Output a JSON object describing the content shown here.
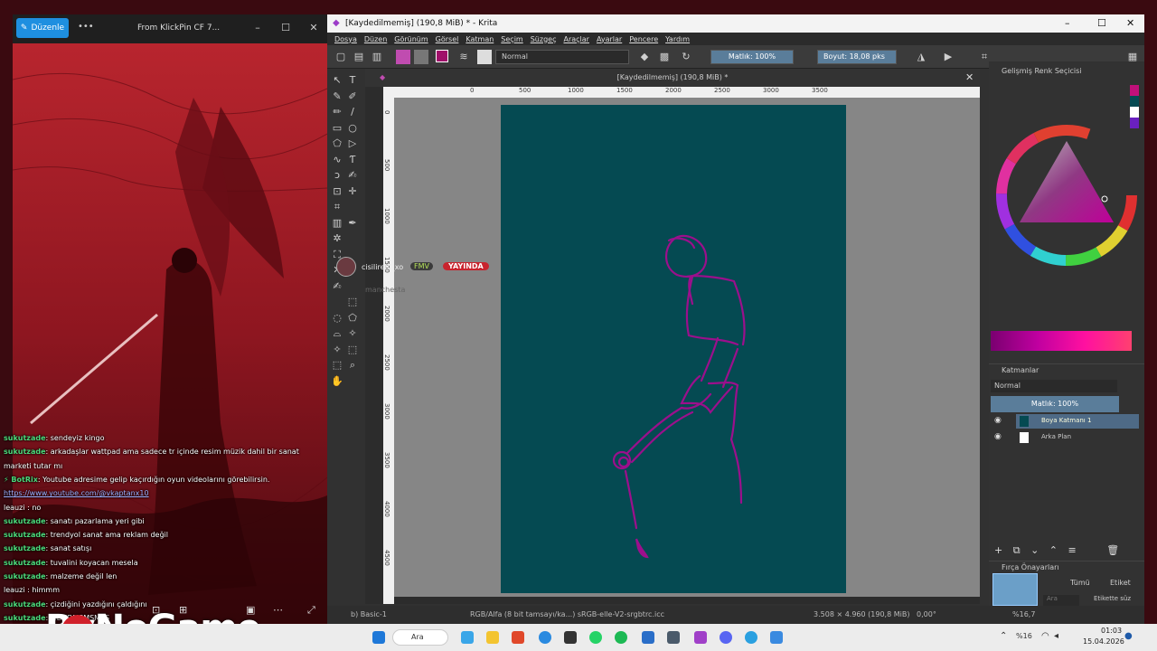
{
  "photos": {
    "edit_label": "Düzenle",
    "more": "•••",
    "title": "From KlickPin CF 7...",
    "min": "–",
    "max": "☐",
    "close": "✕"
  },
  "chat": [
    {
      "user": "sukutzade",
      "text": ": sendeyiz kingo"
    },
    {
      "user": "sukutzade",
      "text": ": arkadaşlar wattpad ama sadece tr içinde resim müzik dahil bir sanat"
    },
    {
      "user": "",
      "text": "marketi tutar mı"
    },
    {
      "user": "⚡ BotRix",
      "text": ": Youtube adresime gelip kaçırdığın oyun videolarını görebilirsin."
    },
    {
      "user": "",
      "text": "https://www.youtube.com/@vkaptanx10",
      "link": true
    },
    {
      "user": "",
      "text": "leauzi : no"
    },
    {
      "user": "sukutzade",
      "text": ": sanatı pazarlama yeri gibi"
    },
    {
      "user": "sukutzade",
      "text": ": trendyol sanat ama reklam değil"
    },
    {
      "user": "sukutzade",
      "text": ": sanat satışı"
    },
    {
      "user": "sukutzade",
      "text": ": tuvalini koyacan mesela"
    },
    {
      "user": "sukutzade",
      "text": ": malzeme değil len"
    },
    {
      "user": "",
      "text": "leauzi : himmm"
    },
    {
      "user": "sukutzade",
      "text": ": çizdiğini yazdığını çaldığını"
    },
    {
      "user": "sukutzade",
      "text": ": MDKDMSMSMŞS"
    }
  ],
  "logo": "ByNoGame",
  "krita": {
    "title": "[Kaydedilmemiş]  (190,8 MiB) * - Krita",
    "menu": [
      "Dosya",
      "Düzen",
      "Görünüm",
      "Görsel",
      "Katman",
      "Seçim",
      "Süzgeç",
      "Araçlar",
      "Ayarlar",
      "Pencere",
      "Yardım"
    ],
    "blend_mode": "Normal",
    "opacity": "Matlık: 100%",
    "size": "Boyut: 18,08 pks",
    "doc_tab": "[Kaydedilmemiş]  (190,8 MiB) *",
    "ruler_h": [
      "0",
      "500",
      "1000",
      "1500",
      "2000",
      "2500",
      "3000",
      "3500"
    ],
    "ruler_v": [
      "0",
      "500",
      "1000",
      "1500",
      "2000",
      "2500",
      "3000",
      "3500",
      "4000",
      "4500"
    ],
    "stream_overlay": {
      "user": "cisiliredi_xo",
      "badge": "FMV",
      "live": "YAYINDA",
      "sub": "manchesta"
    },
    "status": {
      "brush": "b) Basic-1",
      "color": "RGB/Alfa (8 bit tamsayı/ka...) sRGB-elle-V2-srgbtrc.icc",
      "dims": "3.508 × 4.960 (190,8 MiB)",
      "angle": "0,00°",
      "zoom": "%16,7"
    },
    "color_docker_title": "Gelişmiş Renk Seçicisi",
    "layers_title": "Katmanlar",
    "layers_blend": "Normal",
    "layers_opacity": "Matlık:  100%",
    "layers": [
      {
        "name": "Boya Katmanı 1",
        "active": true
      },
      {
        "name": "Arka Plan",
        "active": false
      }
    ],
    "brush_presets_title": "Fırça Önayarları",
    "preset_filter": "Tümü",
    "preset_tag": "Etiket",
    "preset_search": "Ara",
    "preset_tag_filter": "Etikette süz"
  },
  "taskbar": {
    "search": "Ara",
    "time": "01:03",
    "date": "15.04.2026"
  },
  "colors": {
    "canvas_bg": "#054a52",
    "stroke": "#9c0f8c",
    "accent": "#1e8fe0"
  }
}
